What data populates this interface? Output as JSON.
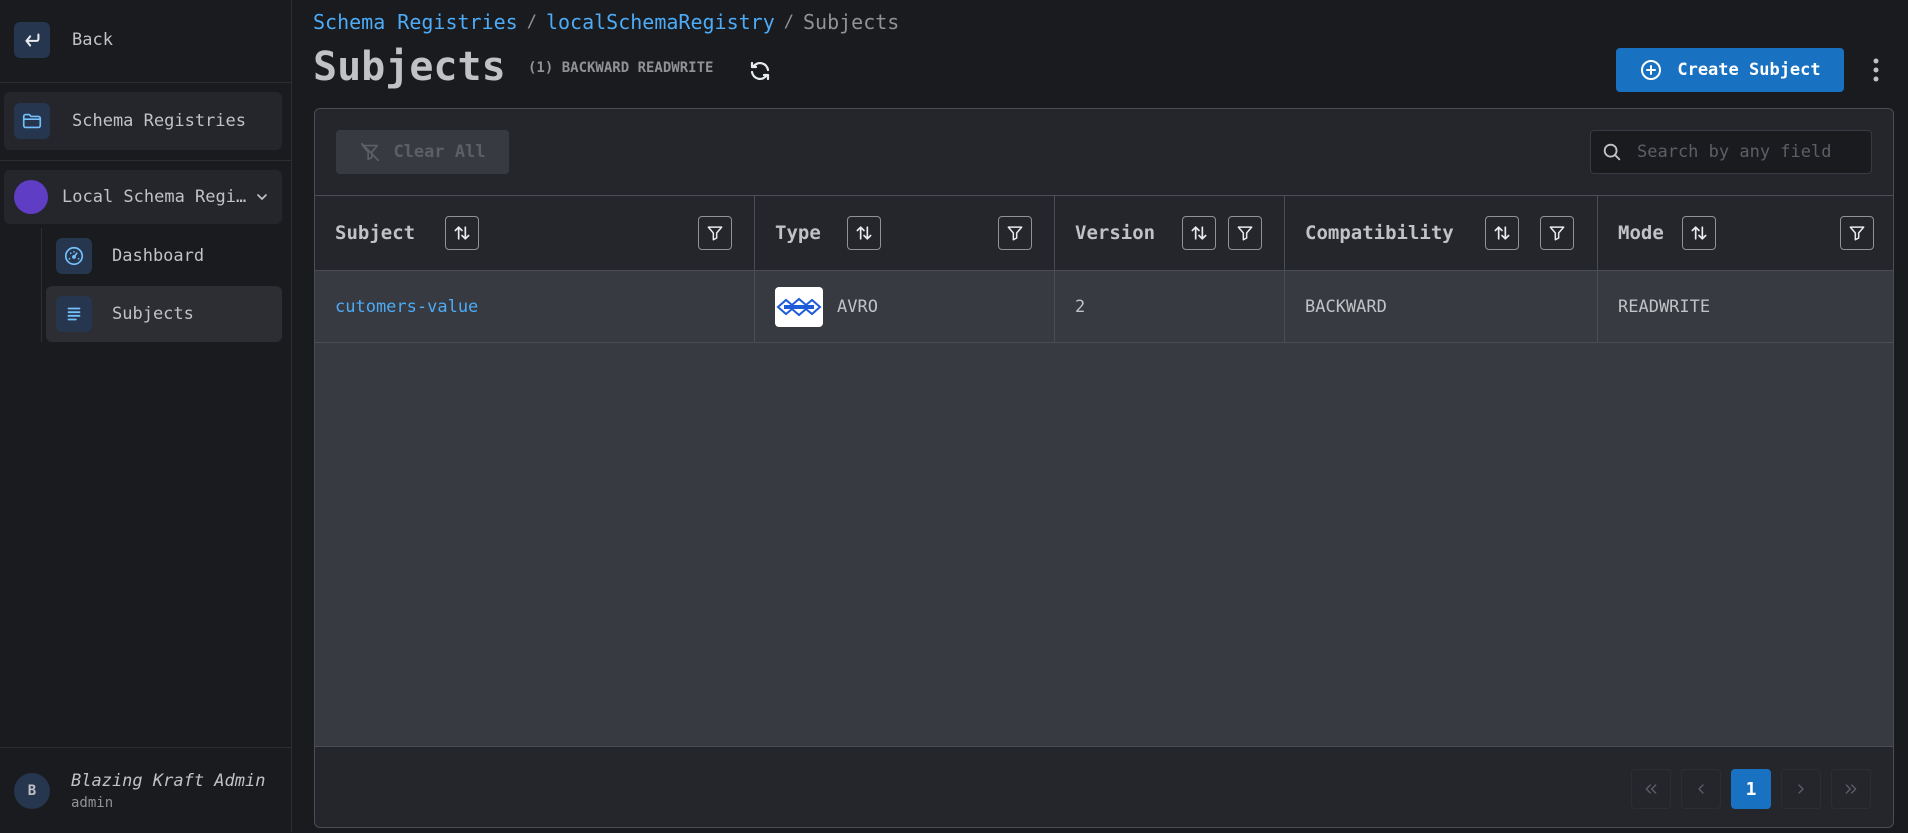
{
  "sidebar": {
    "back_label": "Back",
    "schema_registries_label": "Schema Registries",
    "registry_label": "Local Schema Regi…",
    "items": [
      {
        "label": "Dashboard"
      },
      {
        "label": "Subjects"
      }
    ],
    "user": {
      "initial": "B",
      "name": "Blazing Kraft Admin",
      "role": "admin"
    }
  },
  "breadcrumb": [
    {
      "label": "Schema Registries"
    },
    {
      "label": "localSchemaRegistry"
    },
    {
      "label": "Subjects"
    }
  ],
  "breadcrumb_sep": "/",
  "header": {
    "title": "Subjects",
    "meta": "(1) BACKWARD READWRITE",
    "create_label": "Create Subject"
  },
  "toolbar": {
    "clear_label": "Clear All",
    "search_placeholder": "Search by any field"
  },
  "table": {
    "columns": [
      "Subject",
      "Type",
      "Version",
      "Compatibility",
      "Mode"
    ],
    "rows": [
      {
        "subject": "cutomers-value",
        "type": "AVRO",
        "version": "2",
        "compatibility": "BACKWARD",
        "mode": "READWRITE"
      }
    ]
  },
  "pagination": {
    "current_page": "1"
  },
  "colors": {
    "accent": "#1971c2",
    "link": "#4dabf7",
    "avatar": "#5f3dc4"
  },
  "icons": [
    "back-arrow-icon",
    "folder-icon",
    "chevron-down-icon",
    "dashboard-gauge-icon",
    "list-icon",
    "refresh-icon",
    "plus-circle-icon",
    "kebab-menu-icon",
    "filter-off-icon",
    "search-icon",
    "sort-icon",
    "filter-icon",
    "avro-logo"
  ]
}
